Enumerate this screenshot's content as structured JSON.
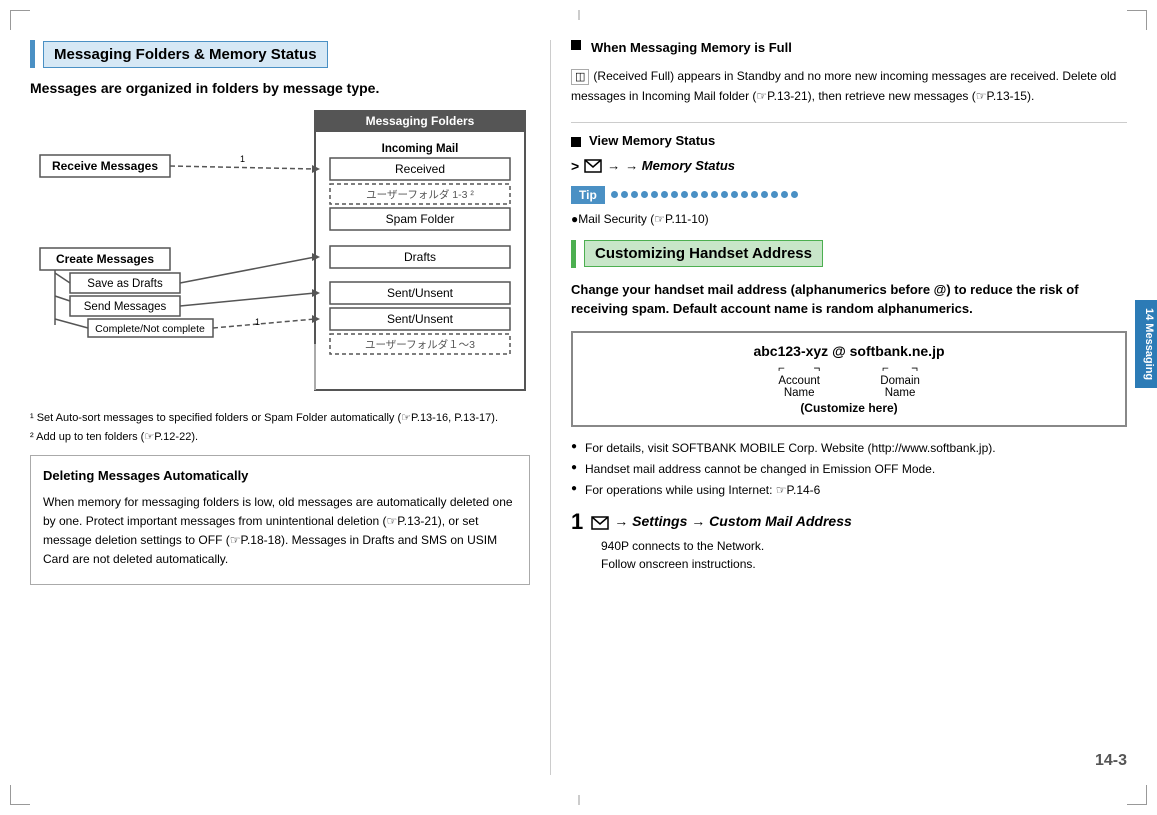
{
  "page": {
    "number": "14-3",
    "chapter_tab": "14\nMessaging"
  },
  "left_section": {
    "title": "Messaging Folders & Memory Status",
    "intro": "Messages are organized in folders by message type.",
    "diagram": {
      "messaging_folders_title": "Messaging Folders",
      "incoming_mail_label": "Incoming Mail",
      "folders": [
        "Received",
        "ユーザーフォルダ 1-3 ²",
        "Spam Folder",
        "Drafts",
        "Sent/Unsent",
        "Sent/Unsent",
        "ユーザーフォルダ１〜3"
      ],
      "receive_messages": "Receive Messages",
      "create_messages": "Create Messages",
      "save_as_drafts": "Save as Drafts",
      "send_messages": "Send Messages",
      "complete_not_complete": "Complete/Not complete"
    },
    "footnotes": [
      "¹  Set Auto-sort messages to specified folders or Spam Folder automatically (☞P.13-16, P.13-17).",
      "²  Add up to ten folders (☞P.12-22)."
    ],
    "info_box": {
      "title": "Deleting Messages Automatically",
      "text": "When memory for messaging folders is low, old messages are automatically deleted one by one. Protect important messages from unintentional deletion (☞P.13-21), or set message deletion settings to OFF (☞P.18-18). Messages in Drafts and SMS on USIM Card are not deleted automatically."
    }
  },
  "right_section": {
    "when_full_title": "When Messaging Memory is Full",
    "when_full_text": "(Received Full) appears in Standby and no more new incoming messages are received. Delete old messages in Incoming Mail folder (☞P.13-21), then retrieve new messages (☞P.13-15).",
    "view_memory": {
      "title": "View Memory Status",
      "step": "→ Memory Status"
    },
    "tip": {
      "label": "Tip",
      "content": "●Mail Security (☞P.11-10)"
    },
    "customizing": {
      "title": "Customizing Handset Address",
      "intro": "Change your handset mail address (alphanumerics before @) to reduce the risk of receiving spam. Default account name is random alphanumerics.",
      "address": {
        "main": "abc123-xyz @ softbank.ne.jp",
        "account_label": "Account\nName",
        "domain_label": "Domain\nName",
        "customize": "(Customize here)"
      },
      "bullets": [
        "For details, visit SOFTBANK MOBILE Corp. Website (http://www.softbank.jp).",
        "Handset mail address cannot be changed in Emission OFF Mode.",
        "For operations while using Internet: ☞P.14-6"
      ],
      "step1": {
        "number": "1",
        "content": "→ Settings → Custom Mail Address",
        "sub": "940P connects to the Network.\nFollow onscreen instructions."
      }
    }
  }
}
